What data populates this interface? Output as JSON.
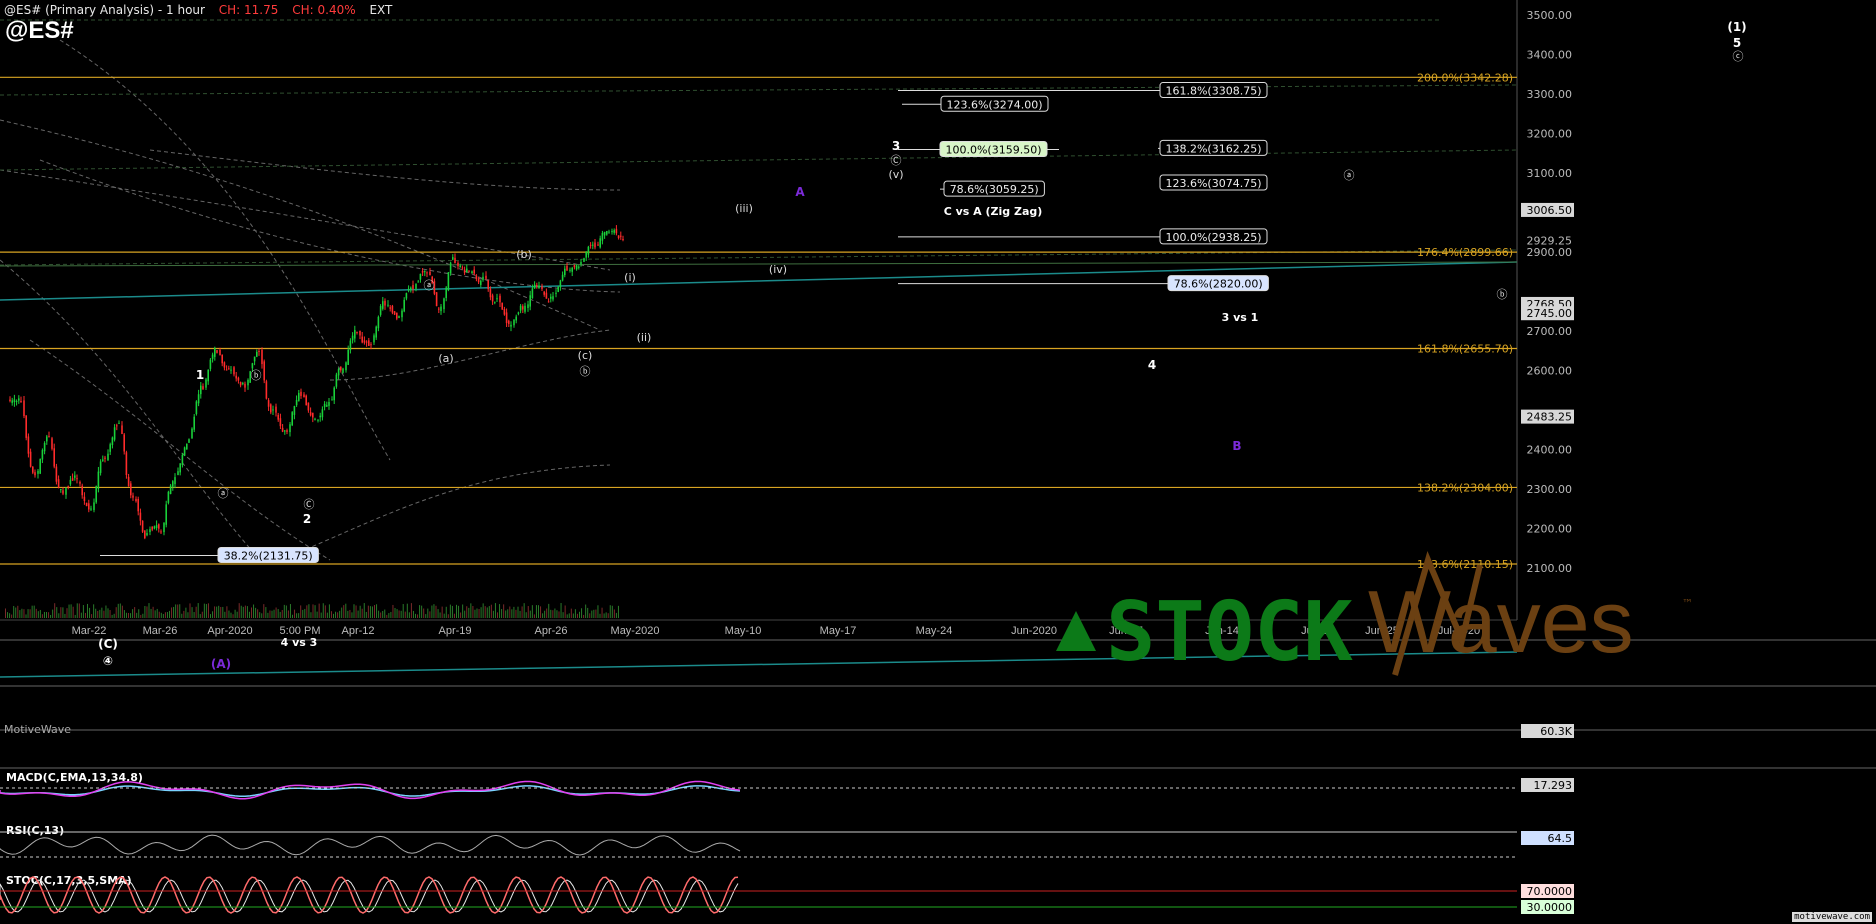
{
  "header": {
    "title": "@ES# (Primary Analysis) - 1 hour",
    "change_points": "CH: 11.75",
    "change_percent": "CH: 0.40%",
    "session": "EXT",
    "symbol": "@ES#"
  },
  "brand": {
    "watermark": "MotiveWave",
    "corner": "motivewave.com"
  },
  "logo": {
    "text_green": "STOCK",
    "text_brown": "Waves",
    "tm": "™",
    "green": "#0c7a18",
    "brown": "#6b4012"
  },
  "colors": {
    "bull": "#19d13a",
    "bear": "#ff2b2b",
    "fib": "#d8a422",
    "channel": "#1b8b8b",
    "macd": "#e23ff0",
    "signal": "#7ad3ff",
    "stoch_k": "#ff6b6b",
    "stoch_d": "#e8e8e8",
    "wave_purple": "#7b2ad8"
  },
  "chart_data": {
    "type": "candlestick",
    "title": "@ES# (Primary Analysis) - 1 hour",
    "x_axis_labels": [
      "Mar-22",
      "Mar-26",
      "Apr-2020",
      "5:00 PM",
      "Apr-12",
      "Apr-19",
      "Apr-26",
      "May-2020",
      "May-10",
      "May-17",
      "May-24",
      "Jun-2020",
      "Jun-07",
      "Jun-14",
      "Jun-21",
      "Jun-25",
      "Jul-2020"
    ],
    "y_axis_ticks": [
      2100,
      2200,
      2300,
      2400,
      2500,
      2600,
      2700,
      2800,
      2900,
      3000,
      3100,
      3200,
      3300,
      3400,
      3500
    ],
    "ylim": [
      2020,
      3540
    ],
    "price_points": [
      [
        0,
        2520
      ],
      [
        1,
        2340
      ],
      [
        2,
        2430
      ],
      [
        3,
        2290
      ],
      [
        4,
        2330
      ],
      [
        5,
        2250
      ],
      [
        6,
        2380
      ],
      [
        7,
        2460
      ],
      [
        8,
        2280
      ],
      [
        9,
        2180
      ],
      [
        10,
        2200
      ],
      [
        11,
        2330
      ],
      [
        12,
        2420
      ],
      [
        13,
        2560
      ],
      [
        14,
        2650
      ],
      [
        15,
        2600
      ],
      [
        16,
        2560
      ],
      [
        17,
        2640
      ],
      [
        18,
        2500
      ],
      [
        19,
        2450
      ],
      [
        20,
        2540
      ],
      [
        21,
        2470
      ],
      [
        22,
        2520
      ],
      [
        23,
        2610
      ],
      [
        24,
        2700
      ],
      [
        25,
        2660
      ],
      [
        26,
        2770
      ],
      [
        27,
        2730
      ],
      [
        28,
        2810
      ],
      [
        29,
        2850
      ],
      [
        30,
        2760
      ],
      [
        31,
        2880
      ],
      [
        32,
        2850
      ],
      [
        33,
        2830
      ],
      [
        34,
        2780
      ],
      [
        35,
        2720
      ],
      [
        36,
        2760
      ],
      [
        37,
        2820
      ],
      [
        38,
        2780
      ],
      [
        39,
        2850
      ],
      [
        40,
        2870
      ],
      [
        41,
        2910
      ],
      [
        42,
        2960
      ],
      [
        43,
        2935
      ]
    ],
    "price_labels": [
      {
        "text": "3500.00",
        "value": 3500,
        "type": "axis"
      },
      {
        "text": "3400.00",
        "value": 3400,
        "type": "axis"
      },
      {
        "text": "3300.00",
        "value": 3300,
        "type": "axis"
      },
      {
        "text": "3200.00",
        "value": 3200,
        "type": "axis"
      },
      {
        "text": "3100.00",
        "value": 3100,
        "type": "axis"
      },
      {
        "text": "3006.50",
        "value": 3006.5,
        "type": "box"
      },
      {
        "text": "2929.25",
        "value": 2929.25,
        "type": "plain"
      },
      {
        "text": "2900.00",
        "value": 2900,
        "type": "axis"
      },
      {
        "text": "2768.50",
        "value": 2768.5,
        "type": "box"
      },
      {
        "text": "2745.00",
        "value": 2745,
        "type": "box"
      },
      {
        "text": "2700.00",
        "value": 2700,
        "type": "axis"
      },
      {
        "text": "2600.00",
        "value": 2600,
        "type": "axis"
      },
      {
        "text": "2483.25",
        "value": 2483.25,
        "type": "box"
      },
      {
        "text": "2400.00",
        "value": 2400,
        "type": "axis"
      },
      {
        "text": "2300.00",
        "value": 2300,
        "type": "axis"
      },
      {
        "text": "2200.00",
        "value": 2200,
        "type": "axis"
      },
      {
        "text": "2100.00",
        "value": 2100,
        "type": "axis"
      }
    ],
    "fib_lines": [
      {
        "label": "200.0%(3342.28)",
        "value": 3342.28
      },
      {
        "label": "176.4%(2899.66)",
        "value": 2899.66
      },
      {
        "label": "161.8%(2655.70)",
        "value": 2655.7
      },
      {
        "label": "138.2%(2304.00)",
        "value": 2304
      },
      {
        "label": "123.6%(2110.15)",
        "value": 2110.15
      }
    ],
    "target_boxes": [
      {
        "label": "161.8%(3308.75)",
        "value": 3308.75,
        "x0": 0,
        "x1": 0
      },
      {
        "label": "123.6%(3274.00)",
        "value": 3274,
        "x0": 0,
        "x1": 0
      },
      {
        "label": "100.0%(3159.50)",
        "value": 3159.5,
        "x0": 0,
        "x1": 0,
        "highlight": true
      },
      {
        "label": "138.2%(3162.25)",
        "value": 3162.25,
        "x0": 0,
        "x1": 0
      },
      {
        "label": "78.6%(3059.25)",
        "value": 3059.25,
        "x0": 0,
        "x1": 0
      },
      {
        "label": "123.6%(3074.75)",
        "value": 3074.75,
        "x0": 0,
        "x1": 0
      },
      {
        "label": "100.0%(2938.25)",
        "value": 2938.25,
        "x0": 0,
        "x1": 0
      },
      {
        "label": "78.6%(2820.00)",
        "value": 2820,
        "x0": 0,
        "x1": 0,
        "blue": true
      },
      {
        "label": "38.2%(2131.75)",
        "value": 2131.75,
        "x0": 0,
        "x1": 0,
        "blue": true
      }
    ],
    "target_notes": [
      "C vs A (Zig Zag)",
      "3 vs 1",
      "4 vs 3"
    ],
    "wave_labels": [
      "1",
      "ⓑ",
      "ⓐ",
      "Ⓒ",
      "2",
      "ⓐ",
      "(a)",
      "(b)",
      "(c)",
      "ⓑ",
      "(i)",
      "(ii)",
      "(iii)",
      "(iv)",
      "(v)",
      "Ⓒ",
      "3",
      "4",
      "(C)",
      "④",
      "(A)",
      "ⓐ",
      "ⓑ",
      "ⓒ",
      "5",
      "(1)",
      "A",
      "B"
    ],
    "indicators": [
      {
        "name": "MACD(C,EMA,13,34,8)",
        "value": "17.293"
      },
      {
        "name": "RSI(C,13)",
        "value": "64.5"
      },
      {
        "name": "STOC(C,17,3,5,SMA)",
        "value_upper": "70.0000",
        "value_lower": "30.0000"
      }
    ],
    "volume_value": "60.3K"
  }
}
